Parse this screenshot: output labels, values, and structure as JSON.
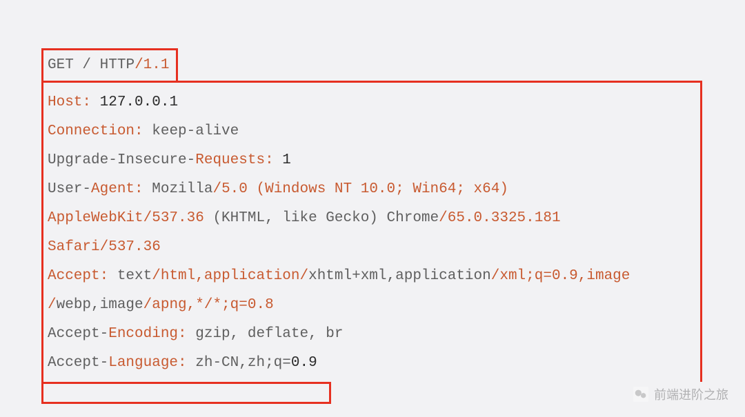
{
  "request_line": {
    "method": "GET",
    "path": "/",
    "protocol": "HTTP",
    "version": "1.1"
  },
  "headers": {
    "host_label": "Host:",
    "host_value": "127.0.0.1",
    "connection_label": "Connection:",
    "connection_value": "keep-alive",
    "upg_1": "Upgrade-Insecure-",
    "upg_2": "Requests:",
    "upg_value": "1",
    "ua_1": "User-",
    "ua_2": "Agent:",
    "ua_mozilla": "Mozilla",
    "ua_slash5": "/5.0",
    "ua_windows": "(Windows NT 10.0; Win64; x64)",
    "ua_webkit": "AppleWebKit",
    "ua_webkit_ver": "/537.36",
    "ua_gecko": "(KHTML, like Gecko)",
    "ua_chrome": "Chrome",
    "ua_chrome_ver": "/65.0.3325.181",
    "ua_safari": "Safari",
    "ua_safari_ver": "/537.36",
    "accept_label": "Accept:",
    "accept_text1": "text",
    "accept_html": "/html,application/",
    "accept_xhtml": "xhtml+xml,application",
    "accept_xml": "/xml;q=0.9,image",
    "accept_webp1": "/",
    "accept_webp2": "webp,image",
    "accept_apng": "/apng,*/*;q=0.8",
    "ae_1": "Accept-",
    "ae_2": "Encoding:",
    "ae_value": "gzip, deflate, br",
    "al_1": "Accept-",
    "al_2": "Language:",
    "al_value": "zh-CN,zh;q=",
    "al_09": "0.9"
  },
  "watermark": {
    "text": "前端进阶之旅"
  }
}
